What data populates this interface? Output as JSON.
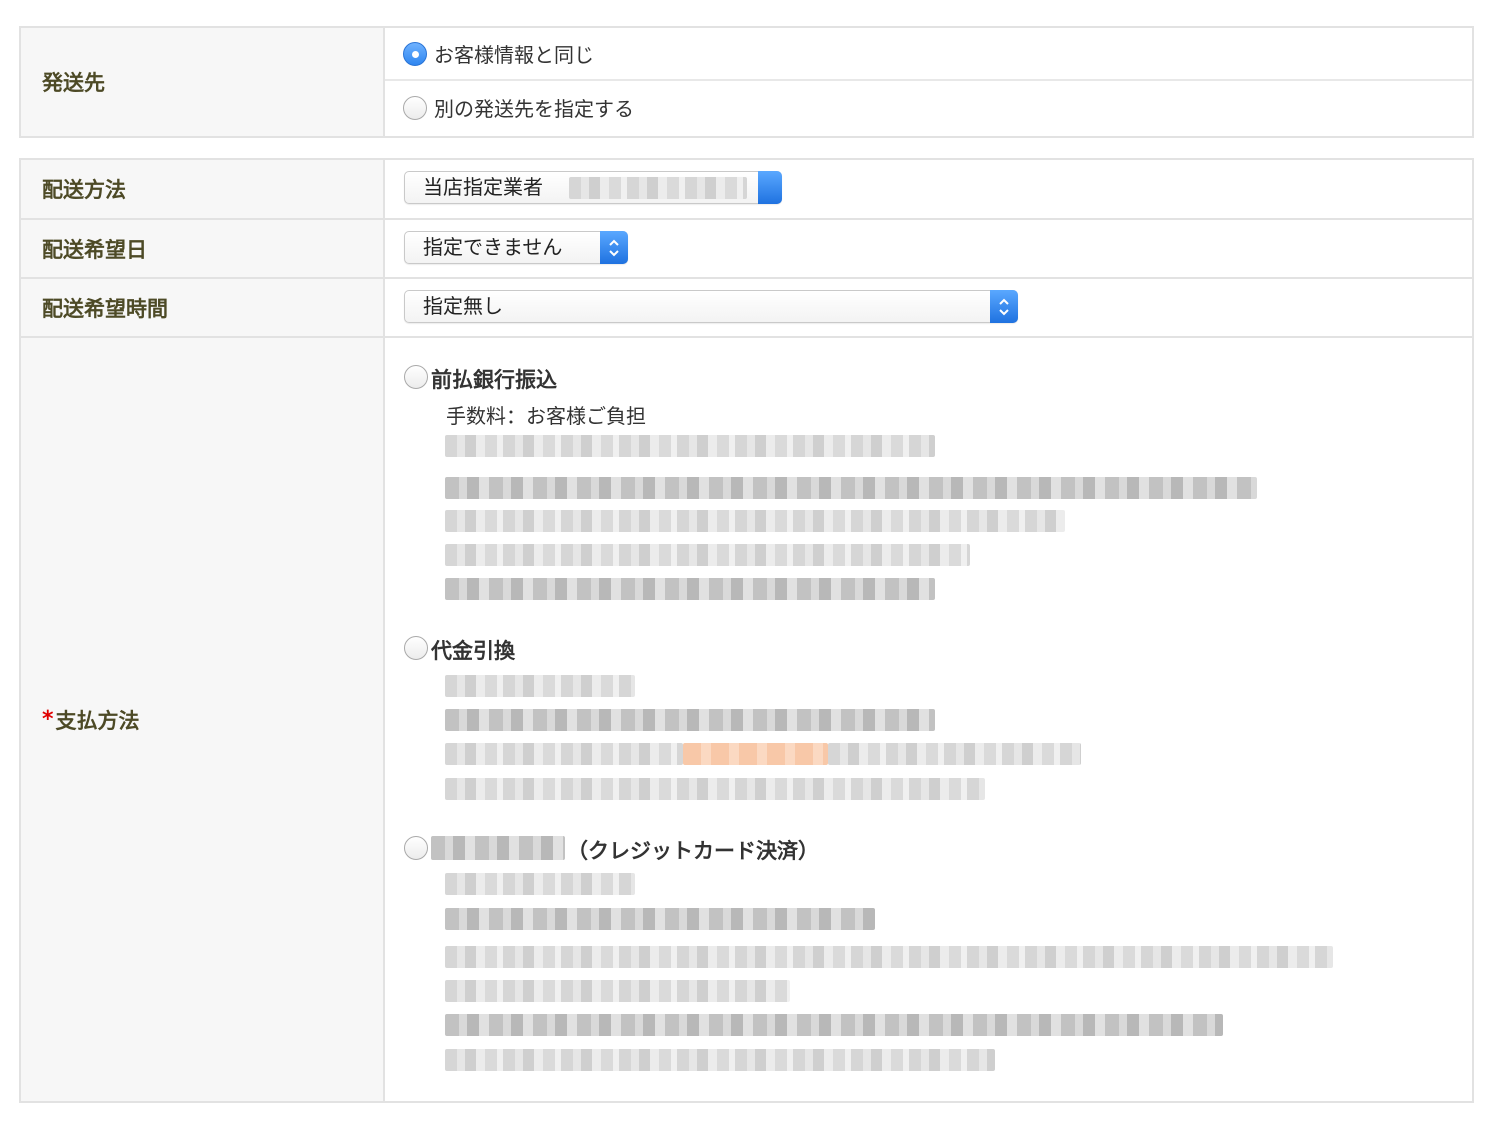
{
  "shipping_dest": {
    "label": "発送先",
    "options": [
      {
        "label": "お客様情報と同じ",
        "selected": true
      },
      {
        "label": "別の発送先を指定する",
        "selected": false
      }
    ]
  },
  "delivery_method": {
    "label": "配送方法",
    "selected": "当店指定業者"
  },
  "delivery_date": {
    "label": "配送希望日",
    "selected": "指定できません"
  },
  "delivery_time": {
    "label": "配送希望時間",
    "selected": "指定無し"
  },
  "payment": {
    "label": "支払方法",
    "required_mark": "*",
    "options": [
      {
        "title": "前払銀行振込",
        "fee": "手数料：お客様ご負担",
        "selected": false
      },
      {
        "title": "代金引換",
        "selected": false
      },
      {
        "title_suffix": "（クレジットカード決済）",
        "selected": false
      }
    ]
  },
  "colors": {
    "label_text": "#4d4a26",
    "required": "#e00000",
    "accent": "#2f86f0",
    "border": "#e2e2e2",
    "label_bg": "#f7f7f7"
  }
}
